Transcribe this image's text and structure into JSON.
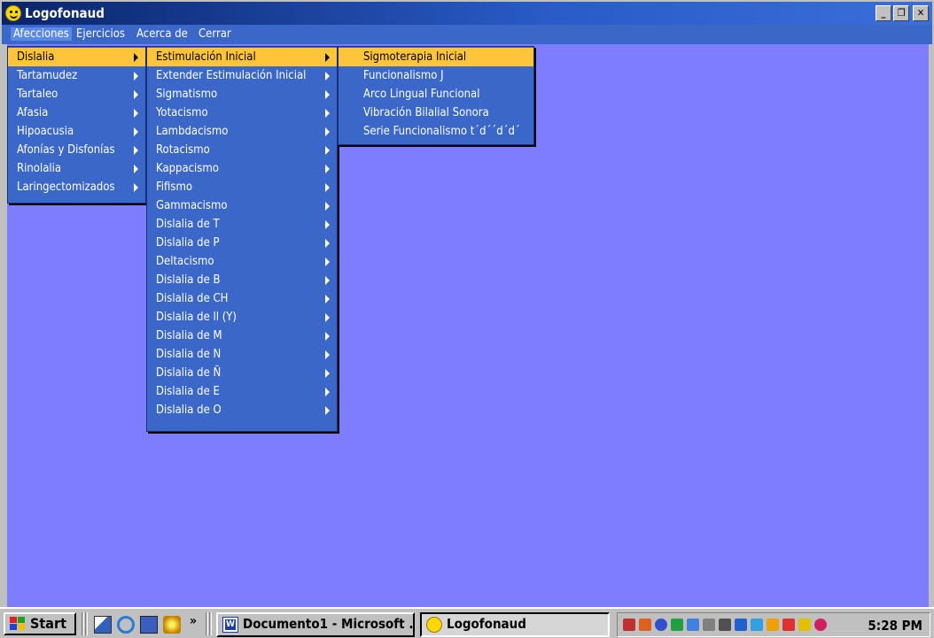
{
  "window": {
    "title": "Logofonaud"
  },
  "menubar": {
    "items": [
      {
        "label": "Afecciones"
      },
      {
        "label": "Ejercicios"
      },
      {
        "label": "Acerca de"
      },
      {
        "label": "Cerrar"
      }
    ]
  },
  "menu_afecciones": {
    "items": [
      {
        "label": "Dislalia",
        "highlighted": true
      },
      {
        "label": "Tartamudez"
      },
      {
        "label": "Tartaleo"
      },
      {
        "label": "Afasia"
      },
      {
        "label": "Hipoacusia"
      },
      {
        "label": "Afonías y Disfonías"
      },
      {
        "label": "Rinolalia"
      },
      {
        "label": "Laringectomizados"
      }
    ]
  },
  "menu_dislalia": {
    "items": [
      {
        "label": "Estimulación Inicial",
        "highlighted": true
      },
      {
        "label": "Extender Estimulación Inicial"
      },
      {
        "label": "Sigmatismo"
      },
      {
        "label": "Yotacismo"
      },
      {
        "label": "Lambdacismo"
      },
      {
        "label": "Rotacismo"
      },
      {
        "label": "Kappacismo"
      },
      {
        "label": "Fifismo"
      },
      {
        "label": "Gammacismo"
      },
      {
        "label": "Dislalia de T"
      },
      {
        "label": "Dislalia de P"
      },
      {
        "label": "Deltacismo"
      },
      {
        "label": "Dislalia de B"
      },
      {
        "label": "Dislalia de CH"
      },
      {
        "label": "Dislalia de ll (Y)"
      },
      {
        "label": "Dislalia de M"
      },
      {
        "label": "Dislalia de N"
      },
      {
        "label": "Dislalia de Ñ"
      },
      {
        "label": "Dislalia de E"
      },
      {
        "label": "Dislalia de O"
      }
    ]
  },
  "menu_estimulacion": {
    "items": [
      {
        "label": "Sigmoterapia Inicial",
        "highlighted": true
      },
      {
        "label": "Funcionalismo J"
      },
      {
        "label": "Arco Lingual Funcional"
      },
      {
        "label": "Vibración Bilalial Sonora"
      },
      {
        "label": "Serie Funcionalismo t´d´´d´d´"
      }
    ]
  },
  "taskbar": {
    "start_label": "Start",
    "tasks": [
      {
        "label": "Documento1 - Microsoft ...",
        "icon": "word-icon"
      },
      {
        "label": "Logofonaud",
        "icon": "smiley-icon"
      }
    ],
    "clock": "5:28 PM"
  },
  "colors": {
    "client_bg": "#7e7cff",
    "menu_bg": "#3b67c8",
    "highlight": "#ffc53a"
  }
}
